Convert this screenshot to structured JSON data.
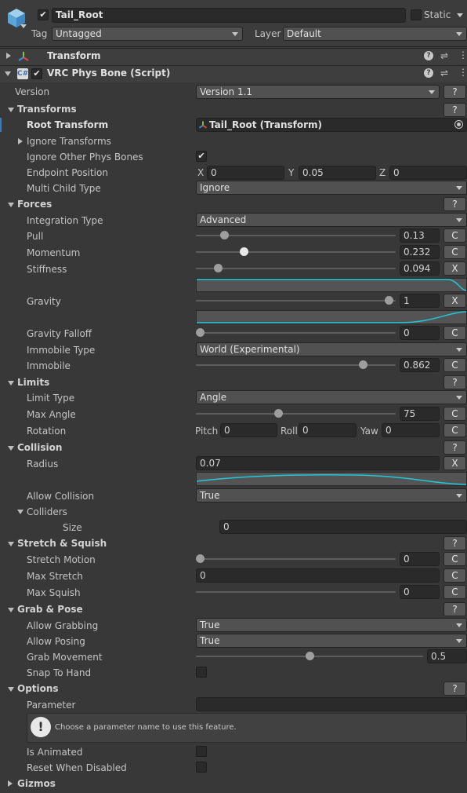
{
  "object": {
    "name": "Tail_Root",
    "static_label": "Static",
    "tag_label": "Tag",
    "tag_value": "Untagged",
    "layer_label": "Layer",
    "layer_value": "Default"
  },
  "components": {
    "transform": "Transform",
    "physbone": "VRC Phys Bone (Script)"
  },
  "version": {
    "label": "Version",
    "value": "Version 1.1"
  },
  "transforms": {
    "header": "Transforms",
    "root_transform_label": "Root Transform",
    "root_transform_value": "Tail_Root (Transform)",
    "ignore_transforms_label": "Ignore Transforms",
    "ignore_other_label": "Ignore Other Phys Bones",
    "endpoint_label": "Endpoint Position",
    "x_label": "X",
    "x": "0",
    "y_label": "Y",
    "y": "0.05",
    "z_label": "Z",
    "z": "0",
    "multi_child_label": "Multi Child Type",
    "multi_child_value": "Ignore"
  },
  "forces": {
    "header": "Forces",
    "integration_label": "Integration Type",
    "integration_value": "Advanced",
    "pull_label": "Pull",
    "pull": "0.13",
    "momentum_label": "Momentum",
    "momentum": "0.232",
    "stiffness_label": "Stiffness",
    "stiffness": "0.094",
    "gravity_label": "Gravity",
    "gravity": "1",
    "gravity_falloff_label": "Gravity Falloff",
    "gravity_falloff": "0",
    "immobile_type_label": "Immobile Type",
    "immobile_type_value": "World (Experimental)",
    "immobile_label": "Immobile",
    "immobile": "0.862"
  },
  "limits": {
    "header": "Limits",
    "limit_type_label": "Limit Type",
    "limit_type_value": "Angle",
    "max_angle_label": "Max Angle",
    "max_angle": "75",
    "rotation_label": "Rotation",
    "pitch_label": "Pitch",
    "pitch": "0",
    "roll_label": "Roll",
    "roll": "0",
    "yaw_label": "Yaw",
    "yaw": "0"
  },
  "collision": {
    "header": "Collision",
    "radius_label": "Radius",
    "radius": "0.07",
    "allow_collision_label": "Allow Collision",
    "allow_collision_value": "True",
    "colliders_label": "Colliders",
    "size_label": "Size",
    "size": "0"
  },
  "stretch": {
    "header": "Stretch & Squish",
    "stretch_motion_label": "Stretch Motion",
    "stretch_motion": "0",
    "max_stretch_label": "Max Stretch",
    "max_stretch": "0",
    "max_squish_label": "Max Squish",
    "max_squish": "0"
  },
  "grab": {
    "header": "Grab & Pose",
    "allow_grabbing_label": "Allow Grabbing",
    "allow_grabbing_value": "True",
    "allow_posing_label": "Allow Posing",
    "allow_posing_value": "True",
    "grab_movement_label": "Grab Movement",
    "grab_movement": "0.5",
    "snap_label": "Snap To Hand"
  },
  "options": {
    "header": "Options",
    "parameter_label": "Parameter",
    "parameter_value": "",
    "info": "Choose a parameter name to use this feature.",
    "is_animated_label": "Is Animated",
    "reset_label": "Reset When Disabled"
  },
  "gizmos": {
    "header": "Gizmos"
  },
  "buttons": {
    "help": "?",
    "c": "C",
    "x": "X",
    "check": "✔"
  },
  "sliders": {
    "pull": 0.13,
    "momentum": 0.232,
    "stiffness": 0.094,
    "gravity": 1,
    "gravity_falloff": 0,
    "immobile": 0.862,
    "max_angle_fraction": 0.417,
    "stretch_motion": 0,
    "max_squish": 0,
    "grab_movement": 0.5
  },
  "colors": {
    "curve": "#1ec8d8",
    "background": "#383838",
    "field": "#2a2a2a"
  }
}
